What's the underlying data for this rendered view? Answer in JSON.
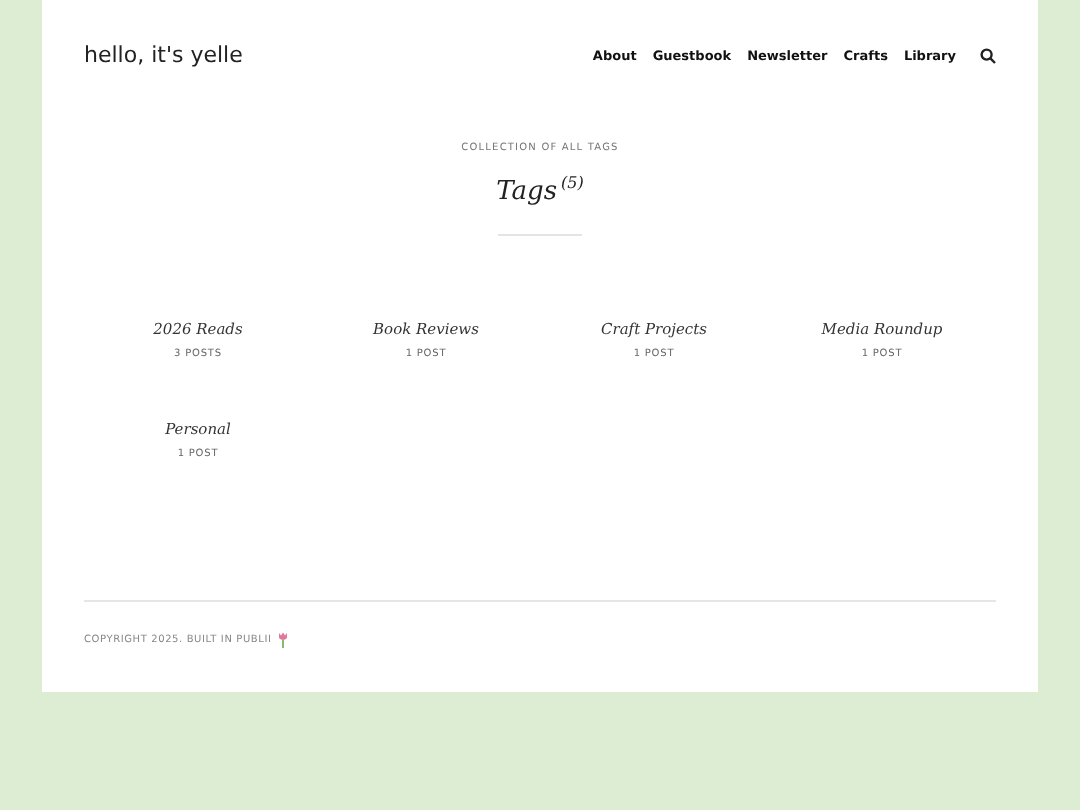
{
  "site_title": "hello, it's yelle",
  "nav": [
    "About",
    "Guestbook",
    "Newsletter",
    "Crafts",
    "Library"
  ],
  "eyebrow": "COLLECTION OF ALL TAGS",
  "heading": "Tags",
  "count": "(5)",
  "tags": [
    {
      "name": "2026 Reads",
      "posts": "3 POSTS"
    },
    {
      "name": "Book Reviews",
      "posts": "1 POST"
    },
    {
      "name": "Craft Projects",
      "posts": "1 POST"
    },
    {
      "name": "Media Roundup",
      "posts": "1 POST"
    },
    {
      "name": "Personal",
      "posts": "1 POST"
    }
  ],
  "footer": "COPYRIGHT 2025. BUILT IN PUBLII"
}
